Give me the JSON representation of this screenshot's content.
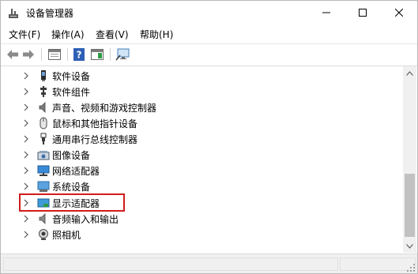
{
  "window": {
    "title": "设备管理器",
    "controls": {
      "minimize": "minimize",
      "maximize": "maximize",
      "close": "close"
    }
  },
  "menubar": {
    "items": [
      "文件(F)",
      "操作(A)",
      "查看(V)",
      "帮助(H)"
    ]
  },
  "toolbar": {
    "icons": [
      "back-icon",
      "forward-icon",
      "properties-icon",
      "help-icon",
      "details-pane-icon",
      "scan-hardware-icon"
    ]
  },
  "tree": {
    "items": [
      {
        "label": "软件设备",
        "icon": "software-device-icon"
      },
      {
        "label": "软件组件",
        "icon": "software-component-icon"
      },
      {
        "label": "声音、视频和游戏控制器",
        "icon": "speaker-icon"
      },
      {
        "label": "鼠标和其他指针设备",
        "icon": "mouse-icon"
      },
      {
        "label": "通用串行总线控制器",
        "icon": "usb-icon"
      },
      {
        "label": "图像设备",
        "icon": "camera-device-icon"
      },
      {
        "label": "网络适配器",
        "icon": "network-adapter-icon"
      },
      {
        "label": "系统设备",
        "icon": "system-device-icon"
      },
      {
        "label": "显示适配器",
        "icon": "display-adapter-icon",
        "highlighted": true
      },
      {
        "label": "音频输入和输出",
        "icon": "audio-io-icon"
      },
      {
        "label": "照相机",
        "icon": "webcam-icon"
      }
    ]
  },
  "colors": {
    "highlight": "#d11b1b",
    "scrollbar_thumb": "#c1c1c1"
  }
}
